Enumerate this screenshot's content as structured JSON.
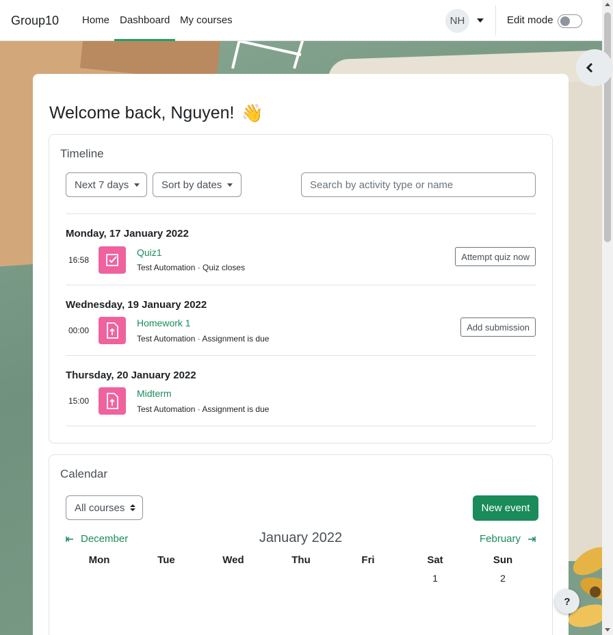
{
  "navbar": {
    "brand": "Group10",
    "links": [
      "Home",
      "Dashboard",
      "My courses"
    ],
    "avatar_initials": "NH",
    "edit_mode_label": "Edit mode"
  },
  "page": {
    "welcome": "Welcome back, Nguyen!",
    "welcome_emoji": "👋"
  },
  "timeline": {
    "title": "Timeline",
    "filter_label": "Next 7 days",
    "sort_label": "Sort by dates",
    "search_placeholder": "Search by activity type or name",
    "days": [
      {
        "heading": "Monday, 17 January 2022",
        "time": "16:58",
        "icon": "quiz-icon",
        "name": "Quiz1",
        "sub": "Test Automation · Quiz closes",
        "action": "Attempt quiz now"
      },
      {
        "heading": "Wednesday, 19 January 2022",
        "time": "00:00",
        "icon": "assignment-icon",
        "name": "Homework 1",
        "sub": "Test Automation · Assignment is due",
        "action": "Add submission"
      },
      {
        "heading": "Thursday, 20 January 2022",
        "time": "15:00",
        "icon": "assignment-icon",
        "name": "Midterm",
        "sub": "Test Automation · Assignment is due",
        "action": ""
      }
    ]
  },
  "calendar": {
    "title": "Calendar",
    "course_filter": "All courses",
    "new_event": "New event",
    "prev_month": "December",
    "current_month": "January 2022",
    "next_month": "February",
    "weekdays": [
      "Mon",
      "Tue",
      "Wed",
      "Thu",
      "Fri",
      "Sat",
      "Sun"
    ],
    "first_row": [
      "",
      "",
      "",
      "",
      "",
      "1",
      "2"
    ]
  },
  "help_label": "?",
  "colors": {
    "accent": "#1a8b5a",
    "activity_icon_bg": "#f0629e"
  }
}
